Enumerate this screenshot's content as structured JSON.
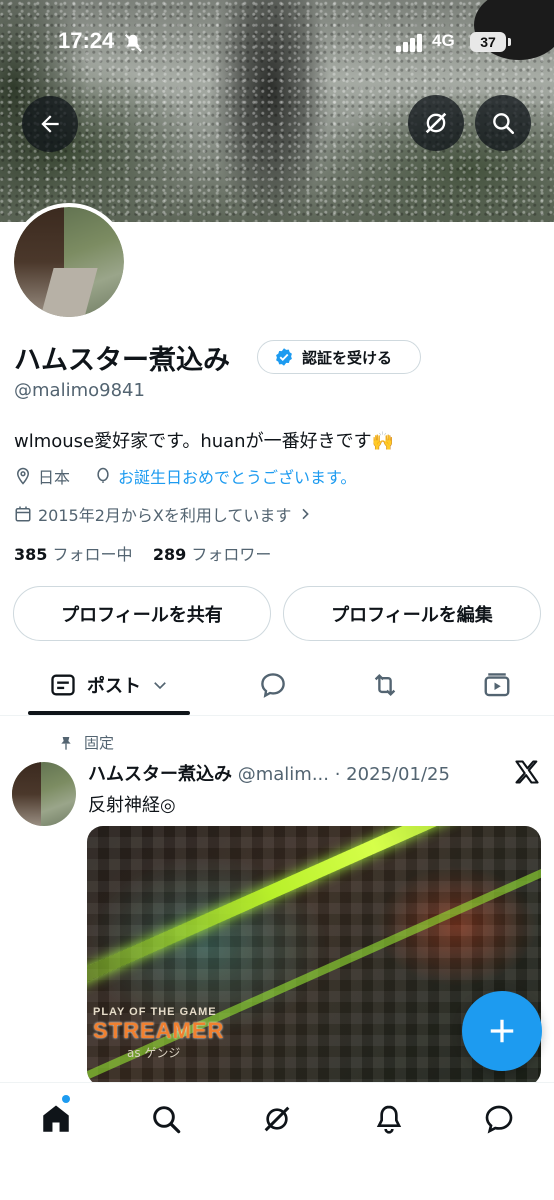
{
  "status_bar": {
    "time": "17:24",
    "network": "4G",
    "battery": "37"
  },
  "profile": {
    "name": "ハムスター煮込み",
    "verify_button": "認証を受ける",
    "handle": "@malimo9841",
    "bio": "wlmouse愛好家です。huanが一番好きです🙌",
    "location": "日本",
    "birthday_text": "お誕生日おめでとうございます。",
    "joined": "2015年2月からXを利用しています",
    "following_count": "385",
    "following_label": "フォロー中",
    "followers_count": "289",
    "followers_label": "フォロワー",
    "share_button": "プロフィールを共有",
    "edit_button": "プロフィールを編集"
  },
  "tabs": {
    "posts_label": "ポスト"
  },
  "pinned_post": {
    "pinned_label": "固定",
    "author_name": "ハムスター煮込み",
    "author_meta": "@malim... · 2025/01/25",
    "text": "反射神経◎",
    "media_caption_top": "PLAY OF THE GAME",
    "media_caption_main": "STREAMER",
    "media_caption_sub": "as ゲンジ"
  },
  "colors": {
    "accent": "#1d9bf0",
    "text": "#0f1419",
    "muted": "#536471",
    "border": "#cfd9de"
  },
  "icons": [
    "back-arrow-icon",
    "grok-icon",
    "search-icon",
    "verified-badge-icon",
    "location-icon",
    "balloon-icon",
    "calendar-icon",
    "chevron-right-icon",
    "posts-icon",
    "chevron-down-icon",
    "reply-icon",
    "repost-icon",
    "video-icon",
    "pin-icon",
    "x-logo-icon",
    "plus-icon",
    "home-icon",
    "bell-icon",
    "messages-icon",
    "bell-mute-icon",
    "signal-icon"
  ]
}
